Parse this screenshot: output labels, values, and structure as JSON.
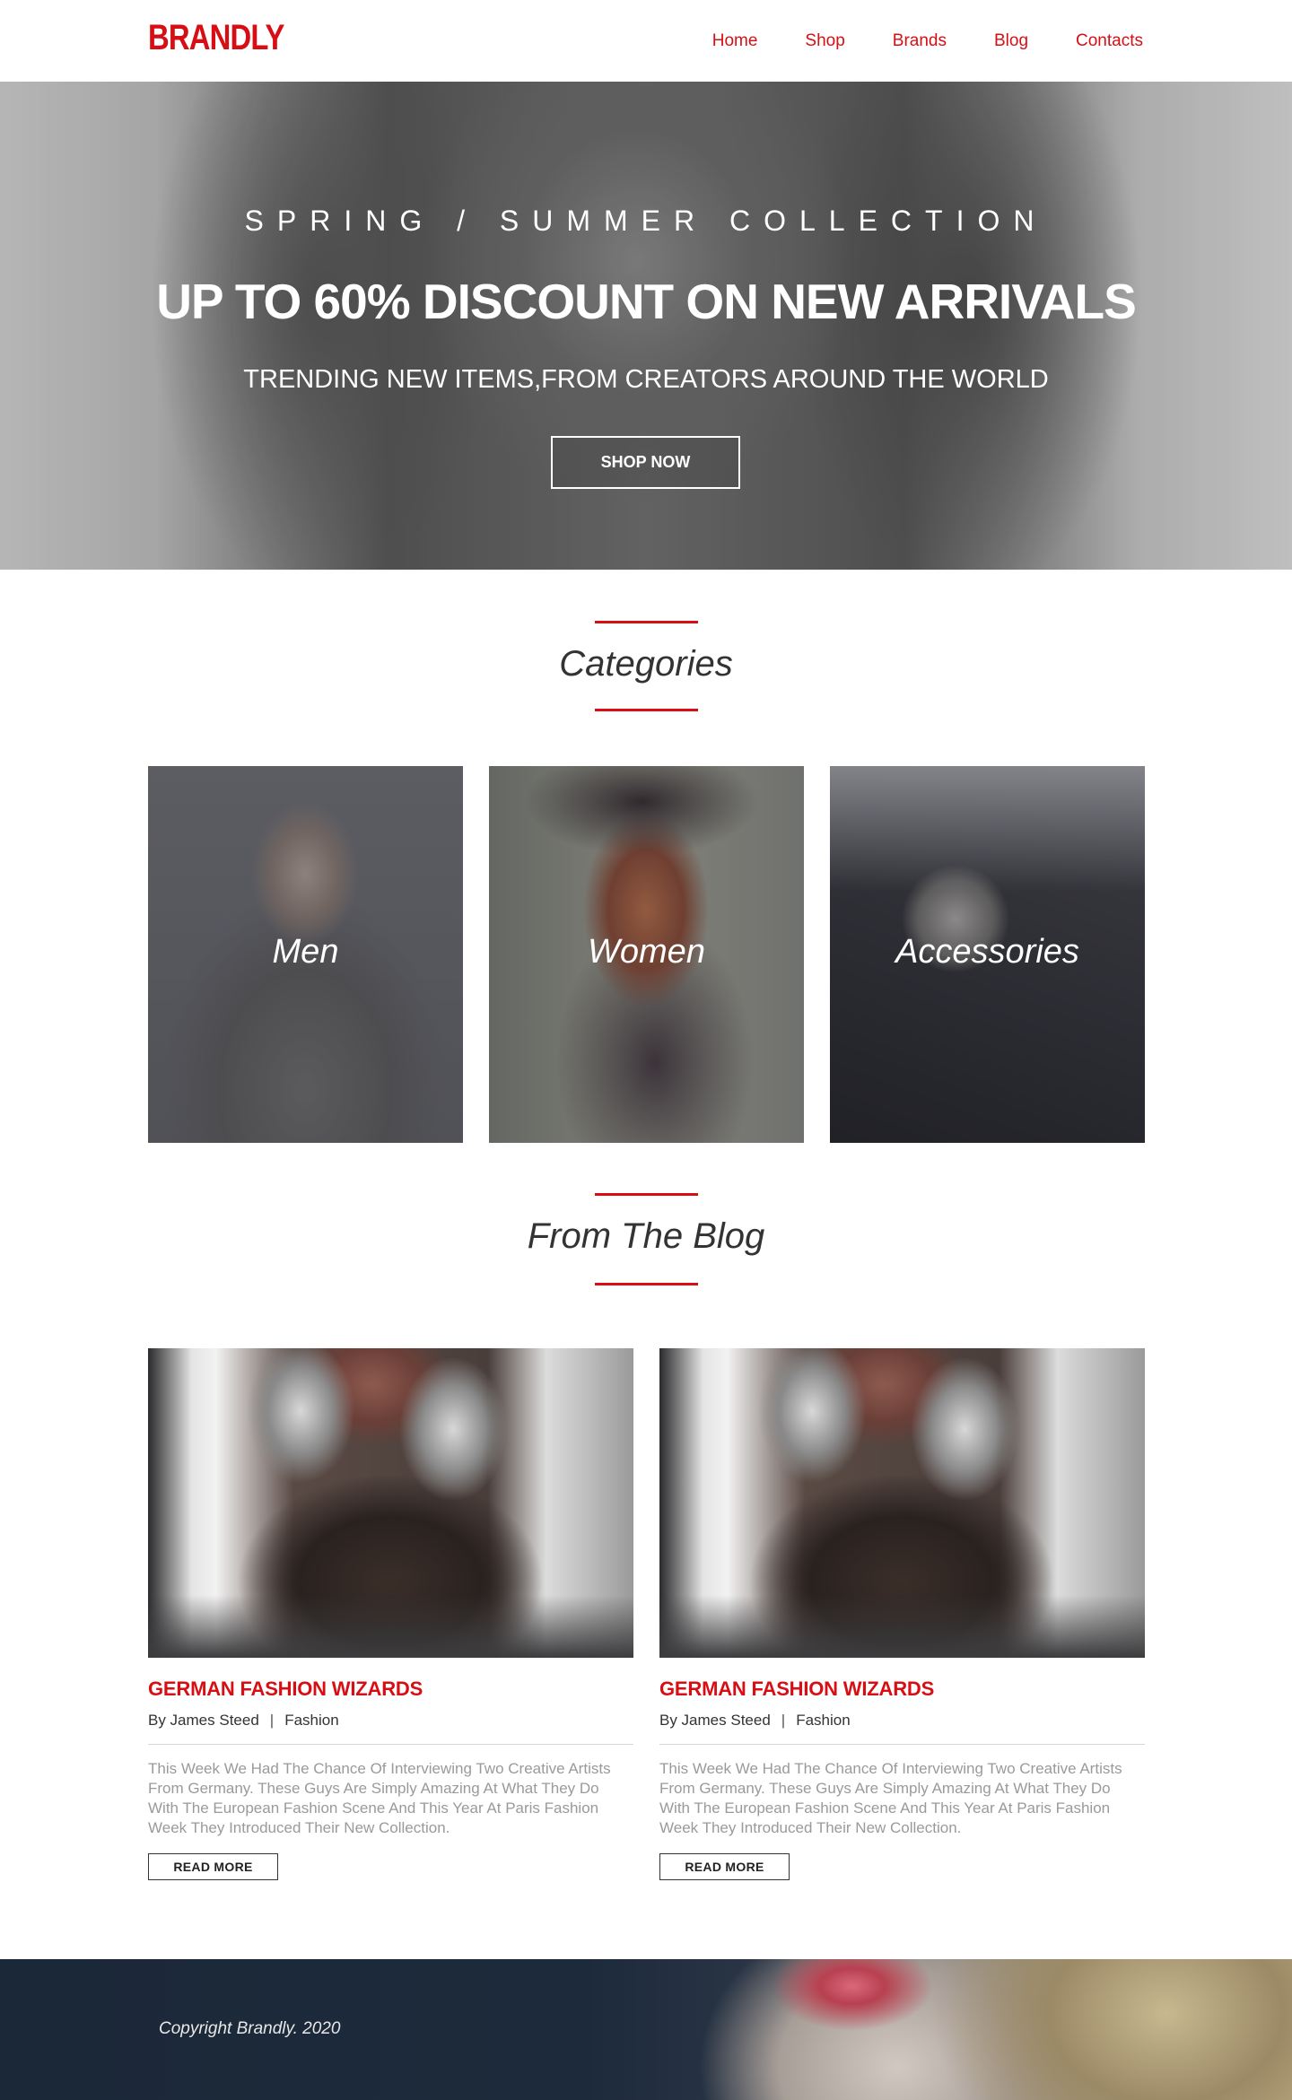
{
  "brand": {
    "logo": "BRANDLY",
    "accent_color": "#d70f15"
  },
  "nav": {
    "items": [
      "Home",
      "Shop",
      "Brands",
      "Blog",
      "Contacts"
    ]
  },
  "hero": {
    "kicker": "SPRING / SUMMER COLLECTION",
    "title": "UP TO 60% DISCOUNT ON NEW ARRIVALS",
    "subtitle": "TRENDING NEW ITEMS,FROM CREATORS AROUND THE WORLD",
    "button": "SHOP NOW"
  },
  "categories": {
    "title": "Categories",
    "items": [
      "Men",
      "Women",
      "Accessories"
    ]
  },
  "blog": {
    "title": "From The Blog",
    "posts": [
      {
        "title": "GERMAN FASHION WIZARDS",
        "author": "By James Steed",
        "category": "Fashion",
        "excerpt": "This Week We Had The Chance Of Interviewing Two Creative Artists From Germany. These Guys Are Simply Amazing At What They Do With The   European Fashion Scene And This Year At Paris Fashion Week They   Introduced Their New Collection.",
        "button": "READ MORE"
      },
      {
        "title": "GERMAN FASHION WIZARDS",
        "author": "By James Steed",
        "category": "Fashion",
        "excerpt": "This Week We Had The Chance Of Interviewing Two Creative Artists From Germany. These Guys Are Simply Amazing At What They Do With The   European Fashion Scene And This Year At Paris Fashion Week They   Introduced Their New Collection.",
        "button": "READ MORE"
      }
    ]
  },
  "footer": {
    "copyright": "Copyright Brandly. 2020"
  }
}
